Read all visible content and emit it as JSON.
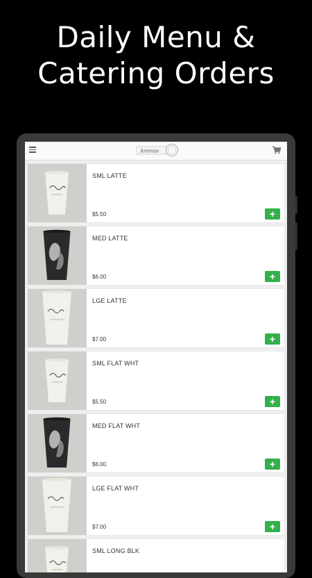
{
  "headline": {
    "line1": "Daily Menu &",
    "line2": "Catering Orders"
  },
  "app": {
    "logo_text": "Aromas",
    "icons": {
      "menu": "hamburger-icon",
      "cart": "cart-icon"
    }
  },
  "colors": {
    "background": "#000000",
    "add_button": "#34b04b",
    "screen": "#efefef"
  },
  "products": [
    {
      "name": "SML LATTE",
      "price": "$5.50",
      "add": "+",
      "cup": "white",
      "size": "small"
    },
    {
      "name": "MED LATTE",
      "price": "$6.00",
      "add": "+",
      "cup": "dark",
      "size": "medium"
    },
    {
      "name": "LGE LATTE",
      "price": "$7.00",
      "add": "+",
      "cup": "white",
      "size": "large"
    },
    {
      "name": "SML FLAT WHT",
      "price": "$5.50",
      "add": "+",
      "cup": "white",
      "size": "small"
    },
    {
      "name": "MED FLAT WHT",
      "price": "$6.00",
      "add": "+",
      "cup": "dark",
      "size": "medium"
    },
    {
      "name": "LGE FLAT WHT",
      "price": "$7.00",
      "add": "+",
      "cup": "white",
      "size": "large"
    },
    {
      "name": "SML LONG BLK",
      "price": "",
      "add": "",
      "cup": "white",
      "size": "small"
    }
  ]
}
